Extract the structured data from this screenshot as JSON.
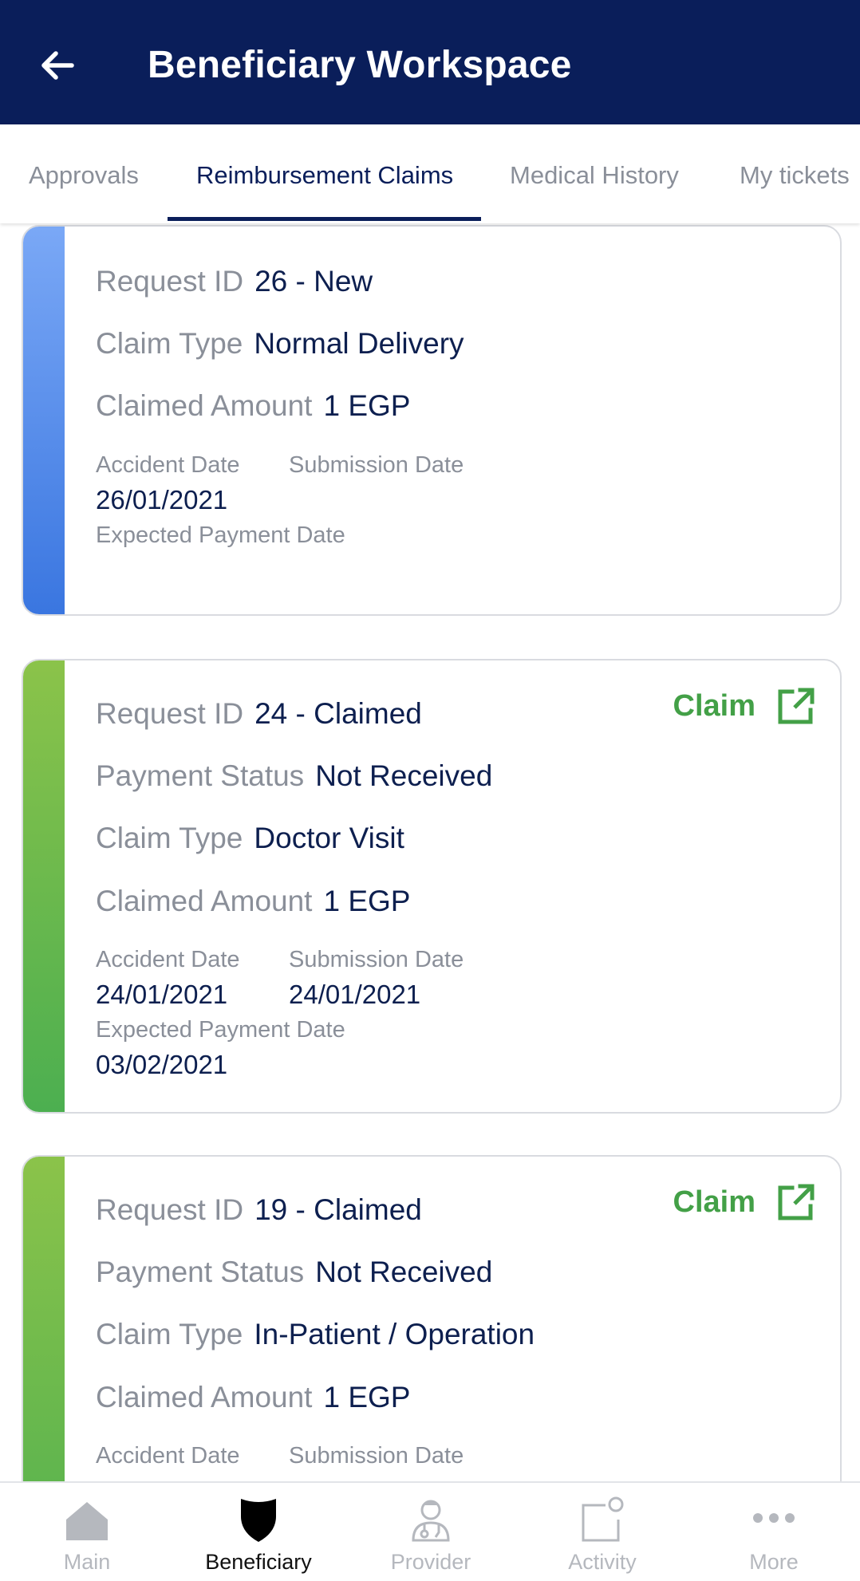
{
  "header": {
    "title": "Beneficiary Workspace"
  },
  "tabs": [
    {
      "label": "Approvals"
    },
    {
      "label": "Reimbursement Claims"
    },
    {
      "label": "Medical History"
    },
    {
      "label": "My tickets"
    }
  ],
  "labels": {
    "request_id": "Request ID",
    "payment_status": "Payment Status",
    "claim_type": "Claim Type",
    "claimed_amount": "Claimed Amount",
    "accident_date": "Accident Date",
    "submission_date": "Submission Date",
    "expected_payment_date": "Expected Payment Date",
    "claim_action": "Claim"
  },
  "claims": [
    {
      "request_id": "26 - New",
      "claim_type": "Normal Delivery",
      "claimed_amount": "1 EGP",
      "accident_date": "26/01/2021",
      "submission_date": "",
      "expected_payment_date": "",
      "status_color": "#3a76e0"
    },
    {
      "request_id": "24 - Claimed",
      "payment_status": "Not Received",
      "claim_type": "Doctor Visit",
      "claimed_amount": "1 EGP",
      "accident_date": "24/01/2021",
      "submission_date": "24/01/2021",
      "expected_payment_date": "03/02/2021",
      "status_color": "#4caf50"
    },
    {
      "request_id": "19 - Claimed",
      "payment_status": "Not Received",
      "claim_type": "In-Patient / Operation",
      "claimed_amount": "1 EGP",
      "status_color": "#4caf50"
    }
  ],
  "bottom_nav": [
    {
      "label": "Main",
      "icon": "home-icon"
    },
    {
      "label": "Beneficiary",
      "icon": "shield-icon"
    },
    {
      "label": "Provider",
      "icon": "doctor-icon"
    },
    {
      "label": "Activity",
      "icon": "notification-icon"
    },
    {
      "label": "More",
      "icon": "more-icon"
    }
  ],
  "colors": {
    "header_bg": "#0a1e5a",
    "claim_green": "#43a047",
    "value_text": "#0d1f4f",
    "label_text": "#8a8f99"
  }
}
